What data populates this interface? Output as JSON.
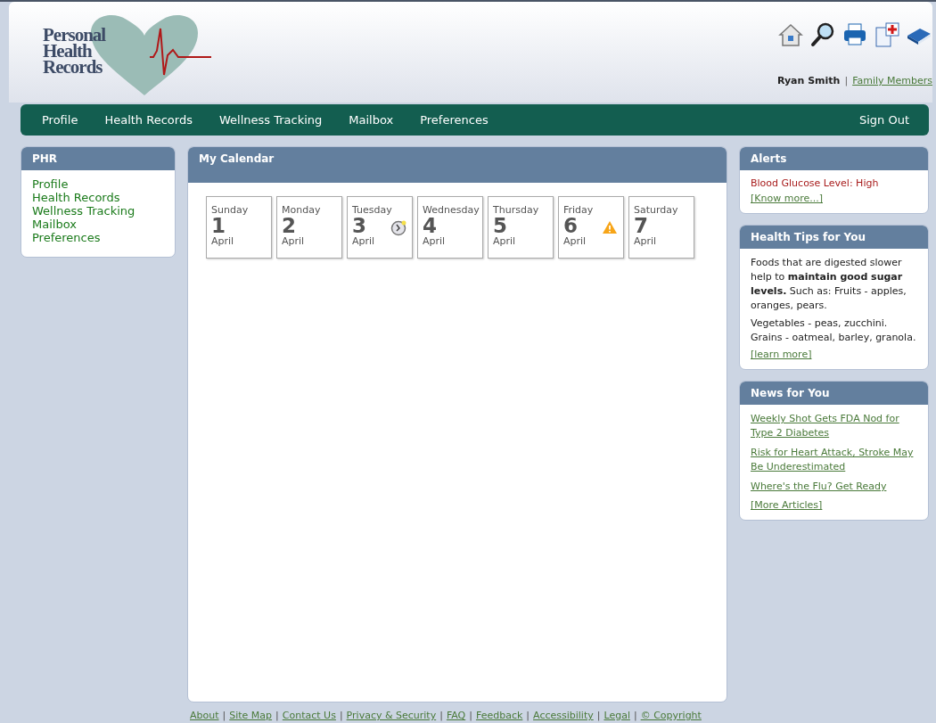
{
  "logo": {
    "lines": [
      "Personal",
      "Health",
      "Records"
    ]
  },
  "header": {
    "user": "Ryan Smith",
    "separator": "|",
    "family_link": "Family Members"
  },
  "nav": {
    "items": [
      "Profile",
      "Health Records",
      "Wellness Tracking",
      "Mailbox",
      "Preferences"
    ],
    "sign_out": "Sign Out"
  },
  "sidebar": {
    "title": "PHR",
    "items": [
      "Profile",
      "Health Records",
      "Wellness Tracking",
      "Mailbox",
      "Preferences"
    ]
  },
  "calendar": {
    "title": "My Calendar",
    "days": [
      {
        "weekday": "Sunday",
        "day": "1",
        "month": "April",
        "kind": "plain"
      },
      {
        "weekday": "Monday",
        "day": "2",
        "month": "April",
        "kind": "plain"
      },
      {
        "weekday": "Tuesday",
        "day": "3",
        "month": "April",
        "kind": "reminder"
      },
      {
        "weekday": "Wednesday",
        "day": "4",
        "month": "April",
        "kind": "plain"
      },
      {
        "weekday": "Thursday",
        "day": "5",
        "month": "April",
        "kind": "plain"
      },
      {
        "weekday": "Friday",
        "day": "6",
        "month": "April",
        "kind": "alert"
      },
      {
        "weekday": "Saturday",
        "day": "7",
        "month": "April",
        "kind": "plain"
      }
    ]
  },
  "alerts": {
    "title": "Alerts",
    "message": "Blood Glucose Level: High",
    "link": "[Know more...]"
  },
  "health_tips": {
    "title": "Health Tips for You",
    "paragraphs": [
      "Foods that are digested slower help to **maintain good sugar levels.** Such as: Fruits - apples, oranges, pears.",
      "Vegetables - peas, zucchini. Grains - oatmeal, barley, granola."
    ],
    "link": "[learn more]"
  },
  "news": {
    "title": "News for You",
    "articles": [
      "Weekly Shot Gets FDA Nod for Type 2 Diabetes",
      "Risk for Heart Attack, Stroke May Be Underestimated",
      "Where's the Flu? Get Ready"
    ],
    "link": "[More Articles]"
  },
  "footer": {
    "links": [
      "About",
      "Site Map",
      "Contact Us",
      "Privacy & Security",
      "FAQ",
      "Feedback",
      "Accessibility",
      "Legal",
      "© Copyright"
    ],
    "separator": "|"
  }
}
